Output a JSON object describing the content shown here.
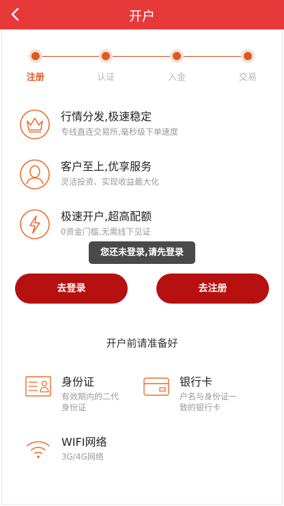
{
  "header": {
    "title": "开户",
    "back_icon": "chevron-left-icon",
    "background": "#e8393a"
  },
  "progress": {
    "accent": "#e05a1e",
    "steps": [
      {
        "label": "注册",
        "active": true
      },
      {
        "label": "认证",
        "active": false
      },
      {
        "label": "入金",
        "active": false
      },
      {
        "label": "交易",
        "active": false
      }
    ]
  },
  "features": [
    {
      "icon": "crown-icon",
      "title": "行情分发,极速稳定",
      "desc": "专线直连交易所,毫秒级下单速度"
    },
    {
      "icon": "person-icon",
      "title": "客户至上,优享服务",
      "desc": "灵活投资、实现收益最大化"
    },
    {
      "icon": "lightning-icon",
      "title": "极速开户,超高配额",
      "desc": "0资金门槛,无需线下见证"
    }
  ],
  "toast": {
    "text": "您还未登录,请先登录"
  },
  "actions": {
    "login_label": "去登录",
    "register_label": "去注册",
    "button_color": "#b71010"
  },
  "prepare": {
    "title": "开户前请准备好",
    "items": [
      {
        "icon": "id-card-icon",
        "name": "身份证",
        "desc_line1": "有效期内的二代",
        "desc_line2": "身份证"
      },
      {
        "icon": "bank-card-icon",
        "name": "银行卡",
        "desc_line1": "户名与身份证一",
        "desc_line2": "致的银行卡"
      },
      {
        "icon": "wifi-icon",
        "name": "WIFI网络",
        "desc_line1": "3G/4G网络",
        "desc_line2": ""
      }
    ]
  }
}
